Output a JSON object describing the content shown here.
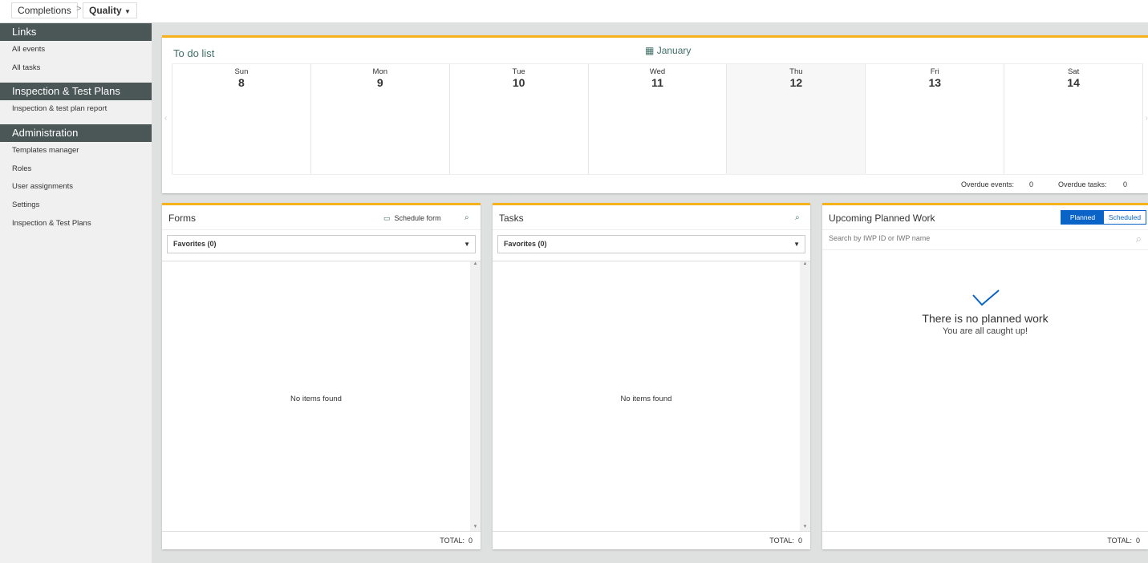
{
  "breadcrumb": {
    "parent": "Completions",
    "separator": ">",
    "current": "Quality"
  },
  "sidebar": {
    "sections": [
      {
        "title": "Links",
        "items": [
          "All events",
          "All tasks"
        ]
      },
      {
        "title": "Inspection & Test Plans",
        "items": [
          "Inspection & test plan report"
        ]
      },
      {
        "title": "Administration",
        "items": [
          "Templates manager",
          "Roles",
          "User assignments",
          "Settings",
          "Inspection & Test Plans"
        ]
      }
    ]
  },
  "calendar": {
    "title": "To do list",
    "month": "January",
    "days": [
      {
        "name": "Sun",
        "num": "8"
      },
      {
        "name": "Mon",
        "num": "9"
      },
      {
        "name": "Tue",
        "num": "10"
      },
      {
        "name": "Wed",
        "num": "11"
      },
      {
        "name": "Thu",
        "num": "12"
      },
      {
        "name": "Fri",
        "num": "13"
      },
      {
        "name": "Sat",
        "num": "14"
      }
    ],
    "overdue_events_label": "Overdue events:",
    "overdue_events": "0",
    "overdue_tasks_label": "Overdue tasks:",
    "overdue_tasks": "0"
  },
  "forms": {
    "title": "Forms",
    "schedule": "Schedule form",
    "filter": "Favorites (0)",
    "empty": "No items found",
    "total_label": "TOTAL:",
    "total": "0"
  },
  "tasks": {
    "title": "Tasks",
    "filter": "Favorites (0)",
    "empty": "No items found",
    "total_label": "TOTAL:",
    "total": "0"
  },
  "upcoming": {
    "title": "Upcoming Planned Work",
    "tabs": [
      "Planned",
      "Scheduled"
    ],
    "search_placeholder": "Search by IWP ID or IWP name",
    "empty_title": "There is no planned work",
    "empty_sub": "You are all caught up!",
    "total_label": "TOTAL:",
    "total": "0"
  },
  "colors": {
    "accent": "#f5b21a",
    "sidebar_header": "#4b5657",
    "primary": "#0a64c8"
  }
}
